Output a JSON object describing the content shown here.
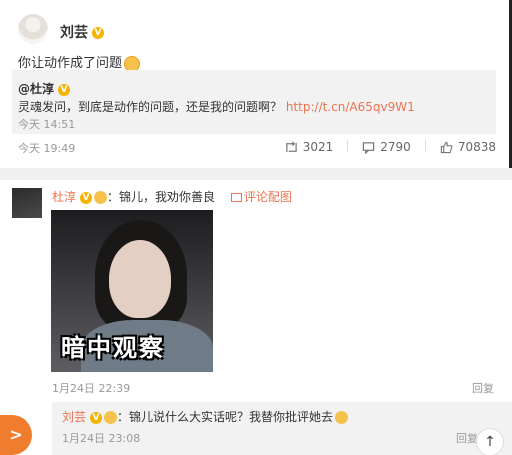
{
  "post": {
    "author": "刘芸",
    "verified_badge": "V",
    "text": "你让动作成了问题",
    "emoji_icon": "smile-emoji-icon",
    "repost": {
      "author": "@杜淳",
      "verified_badge": "V",
      "text": "灵魂发问，到底是动作的问题，还是我的问题啊？",
      "link": "http://t.cn/A65qv9W1",
      "time": "今天 14:51"
    },
    "time": "今天 19:49",
    "actions": {
      "reposts": "3021",
      "comments": "2790",
      "likes": "70838"
    }
  },
  "comment": {
    "author": "杜淳",
    "text": "：锦儿，我劝你善良",
    "pic_link": "评论配图",
    "image_caption": "暗中观察",
    "time": "1月24日 22:39",
    "reply_label": "回复",
    "sub_reply": {
      "author": "刘芸",
      "text": "：锦儿说什么大实话呢？我替你批评她去",
      "time": "1月24日 23:08",
      "reply_label": "回复"
    }
  },
  "colors": {
    "accent": "#eb7350",
    "badge": "#f5b400",
    "fab": "#f07c2e"
  }
}
